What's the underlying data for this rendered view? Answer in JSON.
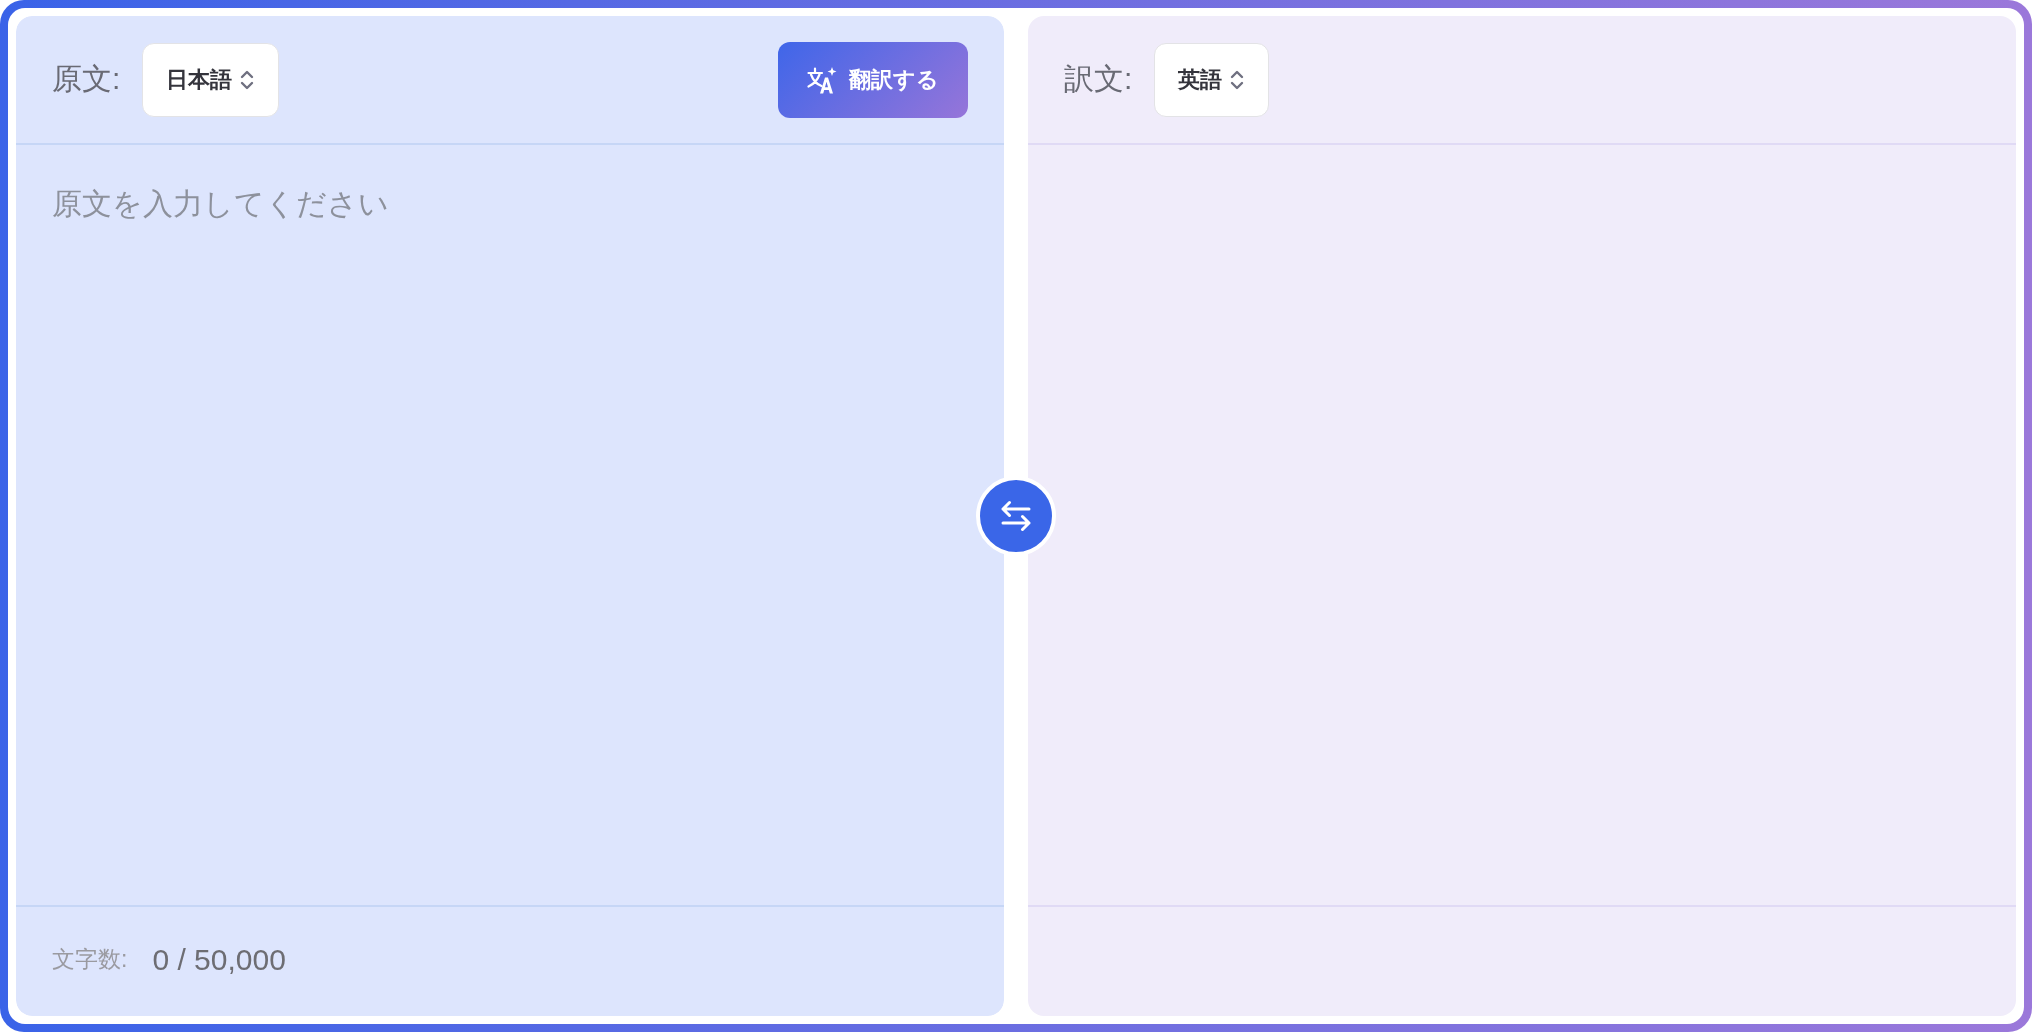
{
  "source": {
    "label": "原文:",
    "language": "日本語",
    "translate_button": "翻訳する",
    "placeholder": "原文を入力してください",
    "char_count_label": "文字数:",
    "char_count": "0 / 50,000"
  },
  "target": {
    "label": "訳文:",
    "language": "英語"
  }
}
